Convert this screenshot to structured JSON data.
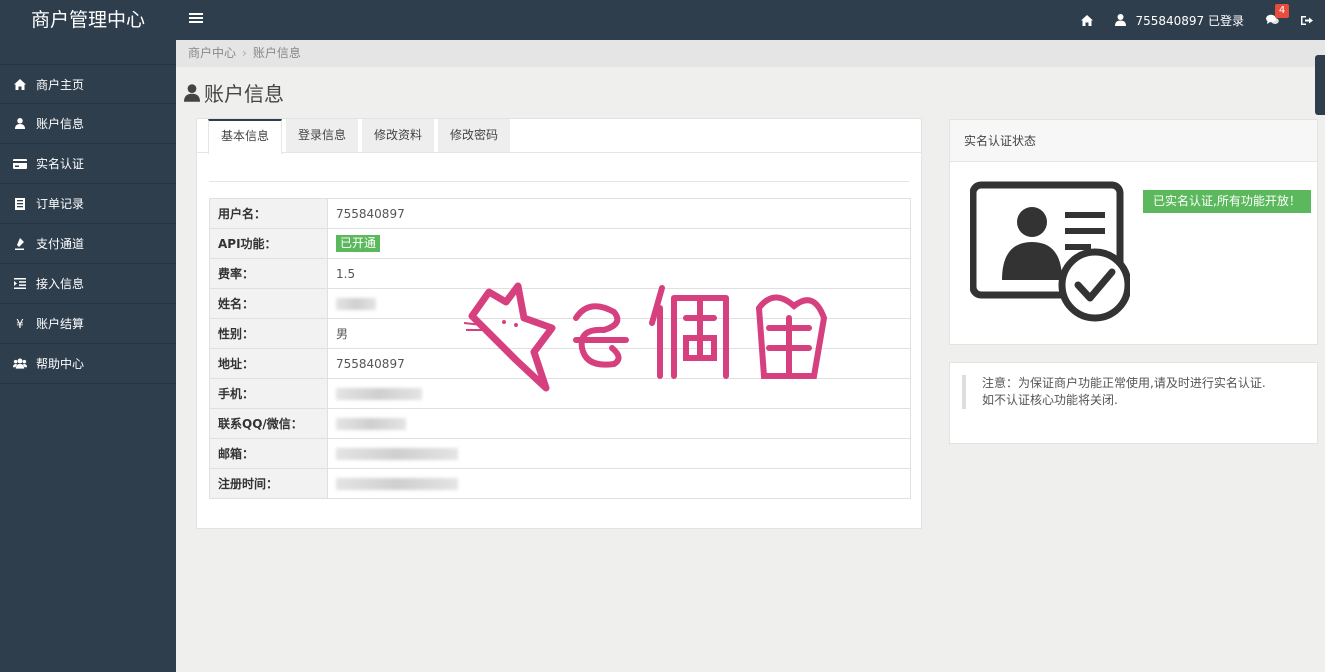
{
  "header": {
    "brand": "商户管理中心",
    "user_label": "755840897 已登录",
    "message_count": "4"
  },
  "sidebar": {
    "items": [
      {
        "label": "商户主页",
        "icon": "home-icon"
      },
      {
        "label": "账户信息",
        "icon": "user-icon"
      },
      {
        "label": "实名认证",
        "icon": "credit-card-icon"
      },
      {
        "label": "订单记录",
        "icon": "list-icon"
      },
      {
        "label": "支付通道",
        "icon": "gavel-icon"
      },
      {
        "label": "接入信息",
        "icon": "indent-icon"
      },
      {
        "label": "账户结算",
        "icon": "yen-icon"
      },
      {
        "label": "帮助中心",
        "icon": "users-icon"
      }
    ]
  },
  "breadcrumb": {
    "root": "商户中心",
    "current": "账户信息"
  },
  "page_title": "账户信息",
  "tabs": [
    "基本信息",
    "登录信息",
    "修改资料",
    "修改密码"
  ],
  "info": {
    "rows": [
      {
        "key": "用户名：",
        "value": "755840897"
      },
      {
        "key": "API功能：",
        "value": "已开通"
      },
      {
        "key": "费率：",
        "value": "1.5"
      },
      {
        "key": "姓名：",
        "value": ""
      },
      {
        "key": "性别：",
        "value": "男"
      },
      {
        "key": "地址：",
        "value": "755840897"
      },
      {
        "key": "手机：",
        "value": ""
      },
      {
        "key": "联系QQ/微信：",
        "value": ""
      },
      {
        "key": "邮箱：",
        "value": ""
      },
      {
        "key": "注册时间：",
        "value": ""
      }
    ]
  },
  "verify": {
    "title": "实名认证状态",
    "status": "已实名认证,所有功能开放！"
  },
  "note": {
    "line1": "注意：为保证商户功能正常使用,请及时进行实名认证.",
    "line2": "如不认证核心功能将关闭."
  },
  "watermark": "奇偶猫",
  "colors": {
    "dark": "#2f3e4d",
    "green": "#5cb85c",
    "badge_red": "#e74c3c",
    "watermark_pink": "#d6407f"
  }
}
